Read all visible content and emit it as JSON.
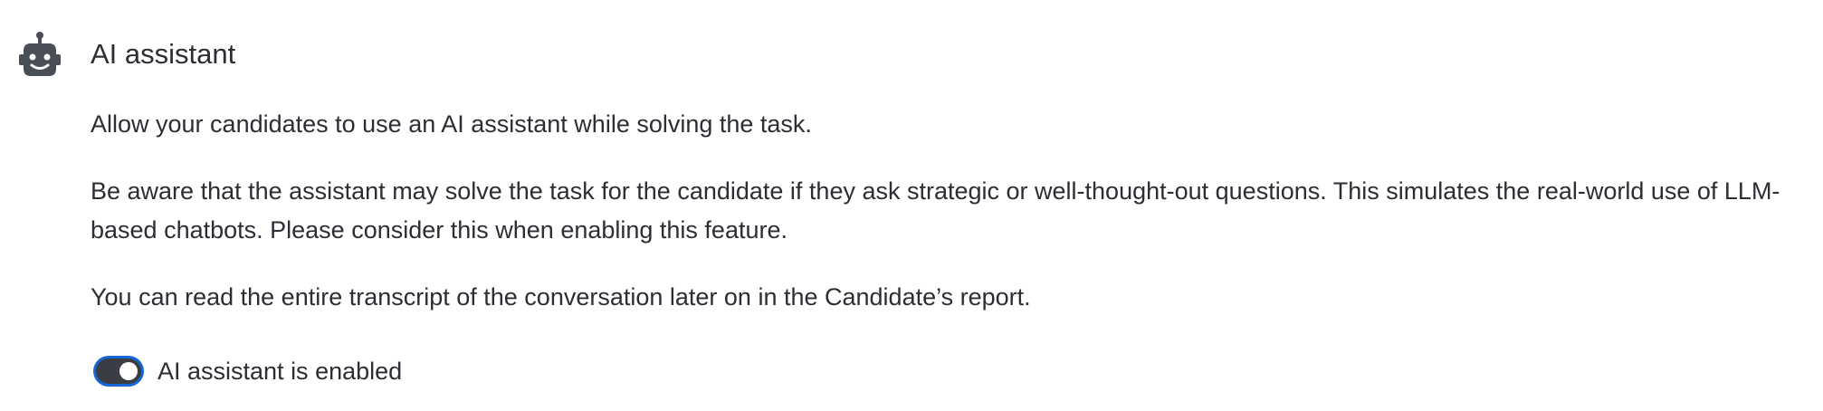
{
  "section": {
    "icon": "robot-icon",
    "title": "AI assistant",
    "paragraphs": [
      "Allow your candidates to use an AI assistant while solving the task.",
      "Be aware that the assistant may solve the task for the candidate if they ask strategic or well-thought-out questions. This simulates the real-world use of LLM-based chatbots. Please consider this when enabling this feature.",
      "You can read the entire transcript of the conversation later on in the Candidate’s report."
    ],
    "toggle": {
      "label": "AI assistant is enabled",
      "checked": true
    }
  },
  "colors": {
    "text": "#2b2e35",
    "icon": "#4a4e56",
    "toggle_track": "#3a3d44",
    "focus_ring": "#1766d6"
  }
}
